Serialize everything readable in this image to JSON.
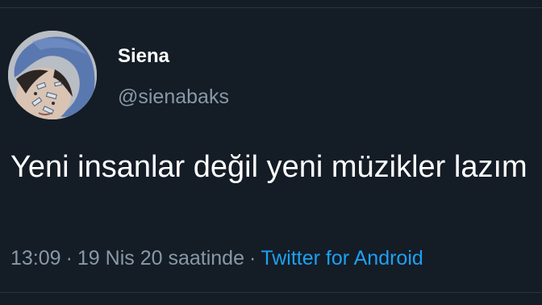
{
  "tweet": {
    "avatar_icon": "profile-avatar-photo",
    "display_name": "Siena",
    "handle": "@sienabaks",
    "text": "Yeni insanlar değil yeni müzikler lazım",
    "time": "13:09",
    "separator": "·",
    "date": "19 Nis 20 saatinde",
    "source": "Twitter for Android"
  },
  "colors": {
    "background": "#141c26",
    "primary_text": "#ffffff",
    "secondary_text": "#8899a6",
    "link": "#1da1f2"
  }
}
